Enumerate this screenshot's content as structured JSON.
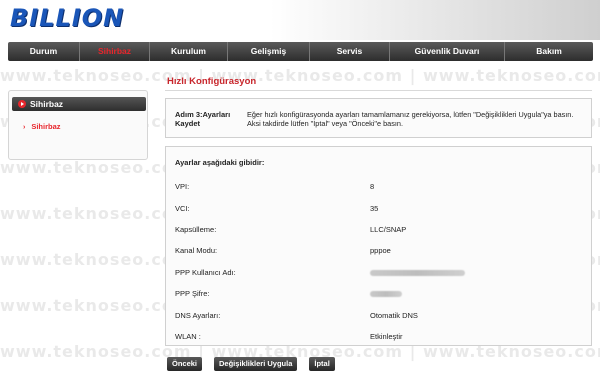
{
  "brand": {
    "logo": "BILLION"
  },
  "nav": [
    {
      "label": "Durum",
      "active": false
    },
    {
      "label": "Sihirbaz",
      "active": true
    },
    {
      "label": "Kurulum",
      "active": false
    },
    {
      "label": "Gelişmiş",
      "active": false
    },
    {
      "label": "Servis",
      "active": false
    },
    {
      "label": "Güvenlik Duvarı",
      "active": false
    },
    {
      "label": "Bakım",
      "active": false
    }
  ],
  "sidebar": {
    "heading": "Sihirbaz",
    "items": [
      {
        "label": "Sihirbaz"
      }
    ]
  },
  "main": {
    "title": "Hızlı Konfigürasyon",
    "step": {
      "label": "Adım 3:Ayarları Kaydet",
      "text": "Eğer hızlı konfigürasyonda ayarları tamamlamanız gerekiyorsa, lütfen \"Değişiklikleri Uygula\"ya basın. Aksi takdirde lütfen \"İptal\" veya \"Önceki\"e basın."
    },
    "settings_heading": "Ayarlar aşağıdaki gibidir:",
    "settings": [
      {
        "label": "VPI:",
        "value": "8"
      },
      {
        "label": "VCI:",
        "value": "35"
      },
      {
        "label": "Kapsülleme:",
        "value": "LLC/SNAP"
      },
      {
        "label": "Kanal Modu:",
        "value": "pppoe"
      },
      {
        "label": "PPP Kullanıcı Adı:",
        "value": ""
      },
      {
        "label": "PPP Şifre:",
        "value": ""
      },
      {
        "label": "DNS Ayarları:",
        "value": "Otomatik DNS"
      },
      {
        "label": "WLAN :",
        "value": "Etkinleştir"
      }
    ]
  },
  "buttons": {
    "prev": "Önceki",
    "apply": "Değişiklikleri Uygula",
    "cancel": "İptal"
  },
  "watermark": "www.teknoseo.com"
}
